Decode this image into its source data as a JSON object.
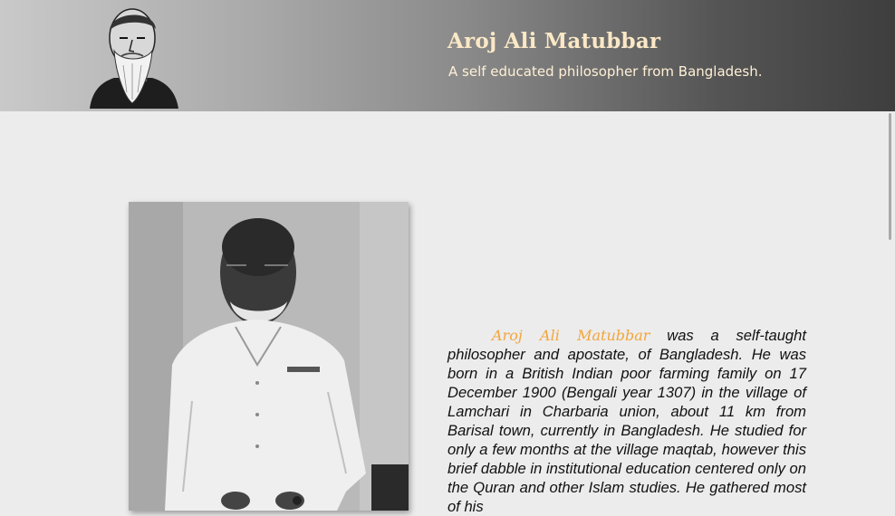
{
  "header": {
    "title": "Aroj Ali Matubbar",
    "subtitle": "A self educated philosopher from Bangladesh."
  },
  "bio": {
    "name": "Aroj Ali Matubbar",
    "text": " was a self-taught philosopher and apostate, of Bangladesh. He was born in a British Indian poor farming family on 17 December 1900 (Bengali year 1307) in the village of Lamchari in Charbaria union, about 11 km from Barisal town, currently in Bangladesh. He studied for only a few months at the village maqtab, however this brief dabble in institutional education centered only on the Quran and other Islam studies. He gathered most of his"
  },
  "colors": {
    "accent_name": "#f3a53a",
    "title": "#fbe8c6",
    "background": "#ececec"
  },
  "icons": {
    "header_portrait": "sketch-portrait-image",
    "main_photo": "photograph-image"
  }
}
